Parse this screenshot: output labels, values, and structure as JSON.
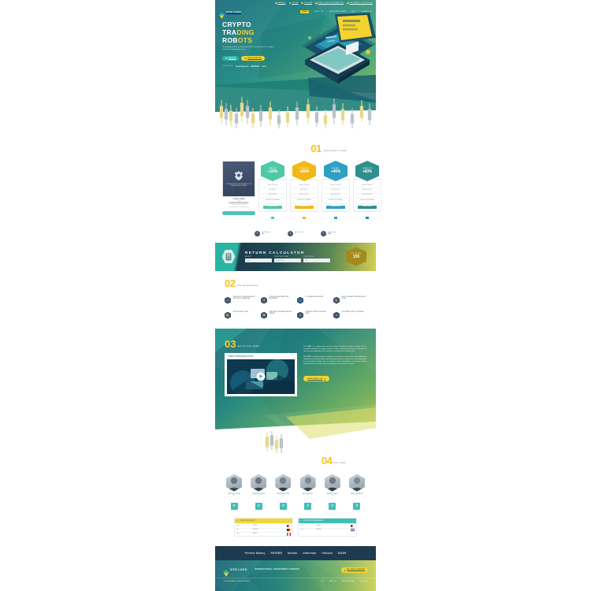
{
  "theme": {
    "teal": "#2bb3a3",
    "yellow": "#f5d32e",
    "dark_navy": "#1e3a4e",
    "green": "#8dc05f"
  },
  "header": {
    "topbar": [
      {
        "icon": "facebook-icon",
        "label": "FACEBOOK"
      },
      {
        "icon": "twitter-icon",
        "label": "TWITTER"
      },
      {
        "icon": "telegram-icon",
        "label": "TELEGRAM"
      },
      {
        "icon": "mail-icon",
        "label": "E-MAIL: SUPPORT@SITENAME.COM"
      },
      {
        "icon": "phone-icon",
        "label": "CALL CENTER: +1 (800) 000-0000"
      }
    ],
    "logo_text": "SITE LOGO",
    "nav": [
      {
        "label": "HOME",
        "active": true
      },
      {
        "label": "ABOUT US",
        "active": false
      },
      {
        "label": "INVESTMENT PLANS",
        "active": false
      },
      {
        "label": "FAQ",
        "active": false
      },
      {
        "label": "CONTACT US",
        "active": false
      }
    ]
  },
  "hero": {
    "title_line1": "CRYPTO",
    "title_line2_a": "TRA",
    "title_line2_b": "DING",
    "title_line3_a": "ROB",
    "title_line3_b": "OTS",
    "subtitle": "Guaranteed profit for investors from 10% to 12% per day. The activity is regulated by Singaporean laws.",
    "btn_primary": "SIGN IN",
    "btn_secondary": "REGISTRATION",
    "partners_label": "OUR PARTNERS:",
    "partners": [
      "Investing.com",
      "BINANCE",
      "etoro"
    ]
  },
  "plans_section": {
    "number": "01",
    "title": "INVESTMENT PLANS",
    "certificate": {
      "heading": "THE CERTIFICATE OF INCORPORATION OF A PRIVATE LIMITED COMPANY",
      "rows": [
        {
          "label": "COMPANY NUMBER",
          "value": "11458392"
        },
        {
          "label": "REGISTERED OFFICE ADDRESS",
          "value": "LONDON, UNITED KINGDOM"
        },
        {
          "label": "Companies Act 2006 / Companies House",
          "value": ""
        }
      ],
      "button": "VIEW CERTIFICATE"
    },
    "plans": [
      {
        "name": "REGULAR",
        "value": "+15%",
        "color": "#4ec9a7",
        "features": [
          "SPAN: 36 HOURS",
          "MIN: $10.00",
          "MAX: $500.00",
          "INSTANT WITHDRAWAL"
        ],
        "button": "ORDER NOW",
        "button_color": "#4ec9a7"
      },
      {
        "name": "INTERMEDIATE",
        "value": "+25%",
        "color": "#f3b718",
        "features": [
          "SPAN: 48 HOURS",
          "MIN: $500.00",
          "MAX: $2 000.00",
          "INSTANT WITHDRAWAL"
        ],
        "button": "ORDER NOW",
        "button_color": "#f3b718"
      },
      {
        "name": "STANDARD",
        "value": "+40%",
        "color": "#2f9fc4",
        "features": [
          "SPAN: 72 HOURS",
          "MIN: $2 000.00",
          "MAX: $10 000.00",
          "INSTANT WITHDRAWAL"
        ],
        "button": "ORDER NOW",
        "button_color": "#2f9fc4"
      },
      {
        "name": "ULTIMATE VIP",
        "value": "+60%",
        "color": "#2f8f8f",
        "features": [
          "SPAN: 96 HOURS",
          "MIN: $10 000.00",
          "MAX: UNLIMITED",
          "INSTANT WITHDRAWAL"
        ],
        "button": "ORDER NOW",
        "button_color": "#2f8f8f"
      }
    ],
    "stats": [
      {
        "icon": "members-icon",
        "label": "Total Members",
        "value": "16"
      },
      {
        "icon": "visitors-icon",
        "label": "Visitors Online",
        "value": "7"
      },
      {
        "icon": "days-icon",
        "label": "Running Days",
        "value": "180"
      }
    ]
  },
  "calculator": {
    "icon": "calculator-icon",
    "title": "RETURN CALCULATOR",
    "fields": [
      {
        "label": "AMOUNT",
        "value": "100"
      },
      {
        "label": "INVESTMENT PLANS",
        "value": "Regular 15%"
      },
      {
        "label": "TOTAL DEPOSIT",
        "value": "$ 0"
      }
    ],
    "badge_label": "TOTAL RETURNS",
    "badge_value": "155"
  },
  "advantages": {
    "number": "02",
    "title": "OUR ADVANTAGES",
    "items": [
      {
        "icon": "law-icon",
        "label": "THE ACTIVITY IS REGULATED BY THE LAW OF SINGAPORE"
      },
      {
        "icon": "shield-icon",
        "label": "OFFICIAL INVESTMENT RISK INSURANCE"
      },
      {
        "icon": "users-icon",
        "label": "12 COMPANY EMPLOYEES"
      },
      {
        "icon": "lock-icon",
        "label": "HIGH CUSTOMER CONFIDENTIALITY LEVEL"
      },
      {
        "icon": "security-icon",
        "label": "HIGH SECURITY LEVEL"
      },
      {
        "icon": "support-icon",
        "label": "QUALIFIED CUSTOMER SUPPORT CENTER"
      },
      {
        "icon": "ddos-icon",
        "label": "THE BEST PROTECTION FROM DDOS"
      },
      {
        "icon": "loyalty-icon",
        "label": "CUSTOMER LOYALTY PROGRAM"
      }
    ]
  },
  "about": {
    "number": "03",
    "title": "ABOUT SITE NAME",
    "video_label": "VIDEO PRESENTATION",
    "paragraph1": "SITE NAME is a cryptocurrency and forex trading international investment company with an impeccable reputation. Our company provides not only a prosperous high return on investments but also maximum confidentiality and security with an unrivaled level of customer service.",
    "paragraph2": "SITE NAME is officially registered in Singapore. This allows our clients with the high reliability and stability that are backed by a global and well-managed investment concept. We use these opportunities for our fundamental strategy, which is to maximize risk-free diversification in the largest and most profitable positions so that you can get a stable long term return on your investment.",
    "button": "MORE ABOUT US"
  },
  "team": {
    "number": "04",
    "title": "OUR TEAM",
    "members": [
      {
        "name": "CRISTIAN LUCERO",
        "role": "CEO"
      },
      {
        "name": "JONATHAN DAVIES",
        "role": "CFO"
      },
      {
        "name": "MATTHEW BISTRO",
        "role": "COO"
      },
      {
        "name": "PAUL SCHMIDT",
        "role": "CTO"
      },
      {
        "name": "ROBERT KARLIS",
        "role": "CMO"
      },
      {
        "name": "MARCO BERMONT",
        "role": "CSO"
      }
    ],
    "icon_row": [
      "doc-icon",
      "doc-icon",
      "doc-icon",
      "doc-icon",
      "doc-icon",
      "doc-icon"
    ]
  },
  "tables": {
    "deposits": {
      "icon": "deposit-icon",
      "title": "LATEST DEPOSITS",
      "rows": [
        {
          "user": "jones",
          "amount": "$700.00",
          "flag": "us"
        },
        {
          "user": "kurt",
          "amount": "$1 450.00",
          "flag": "de"
        },
        {
          "user": "milan",
          "amount": "$320.00",
          "flag": "it"
        }
      ]
    },
    "withdrawals": {
      "icon": "withdraw-icon",
      "title": "LATEST WITHDRAWALS",
      "rows": [
        {
          "user": "lucas",
          "amount": "$230.00",
          "flag": "us"
        },
        {
          "user": "owen",
          "amount": "$890.00",
          "flag": "nl"
        }
      ]
    }
  },
  "footer": {
    "payments": [
      "Perfect Money",
      "PAYEER",
      "bitcoin",
      "ethereum",
      "litecoin",
      "DASH"
    ],
    "logo_text": "SITE LOGO",
    "tagline": "INTERNATIONAL INVESTMENT COMPANY",
    "cta": "BECOME AN INVESTOR",
    "copyright_pre": "© 2020",
    "copyright_brand": "SITE NAME",
    "copyright_post": ". ALL RIGHTS RESERVED.",
    "nav": [
      {
        "label": "HOME",
        "active": true
      },
      {
        "label": "ABOUT US",
        "active": false
      },
      {
        "label": "INVESTMENT PLANS",
        "active": false
      },
      {
        "label": "CONTACT US",
        "active": false
      }
    ]
  }
}
